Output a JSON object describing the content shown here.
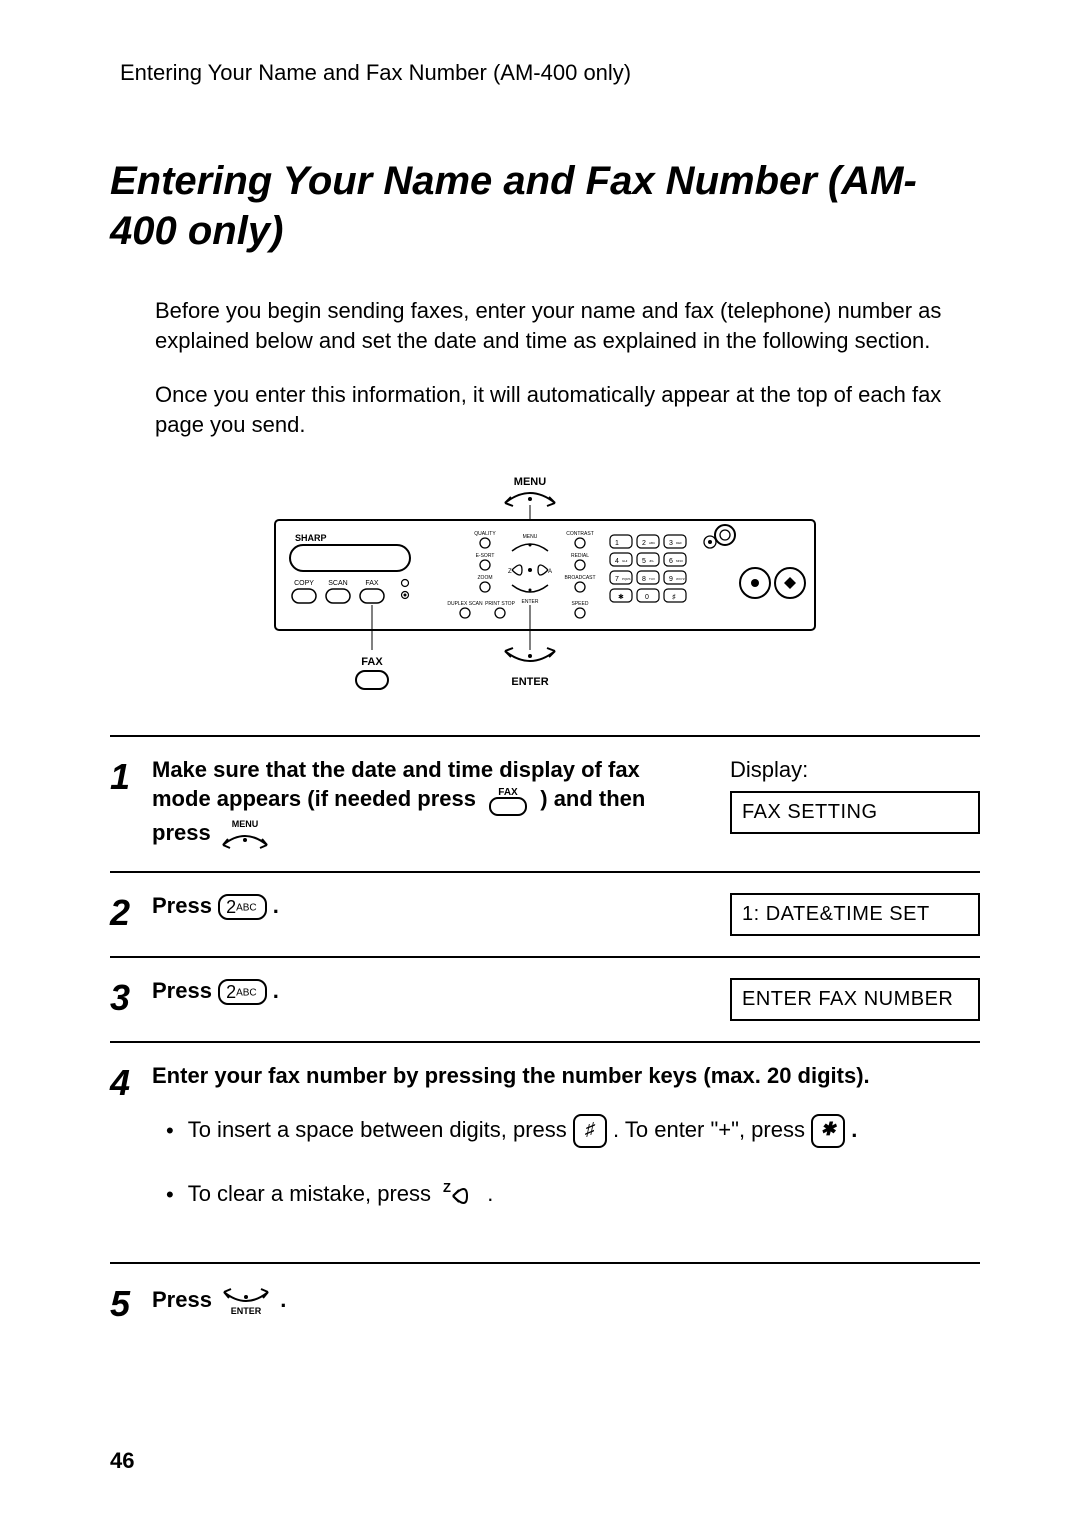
{
  "header": "Entering Your Name and Fax Number (AM-400 only)",
  "title": "Entering Your Name and Fax Number (AM-400 only)",
  "intro1": "Before you begin sending faxes, enter your name and fax (telephone) number as explained below and set the date and time as explained in the following section.",
  "intro2": "Once you enter this information, it will automatically appear at the top of each fax page you send.",
  "panel": {
    "brand": "SHARP",
    "mode_labels": [
      "COPY",
      "SCAN",
      "FAX"
    ],
    "col1": [
      "QUALITY",
      "E-SORT",
      "ZOOM",
      "DUPLEX SCAN",
      "PRINT STOP"
    ],
    "top_center_label": "MENU",
    "rocker_z": "Z",
    "rocker_a": "A",
    "enter_label": "ENTER",
    "col3": [
      "CONTRAST",
      "REDIAL",
      "BROADCAST",
      "SPEED"
    ],
    "keypad": [
      [
        "1",
        ""
      ],
      [
        "2",
        "ABC"
      ],
      [
        "3",
        "DEF"
      ],
      [
        "4",
        "GHI"
      ],
      [
        "5",
        "JKL"
      ],
      [
        "6",
        "MNO"
      ],
      [
        "7",
        "PQRS"
      ],
      [
        "8",
        "TUV"
      ],
      [
        "9",
        "WXYZ"
      ],
      [
        "✱",
        ""
      ],
      [
        "0",
        ""
      ],
      [
        "♯",
        ""
      ]
    ],
    "callout_menu": "MENU",
    "callout_fax": "FAX",
    "callout_enter": "ENTER"
  },
  "steps": {
    "s1": {
      "num": "1",
      "line1": "Make sure that the date and time display of fax mode appears (if needed press",
      "line2": ") and then press",
      "fax_label": "FAX",
      "menu_label": "MENU",
      "display_label": "Display:",
      "display_value": "FAX SETTING"
    },
    "s2": {
      "num": "2",
      "press": "Press",
      "key_main": "2",
      "key_sub": "ABC",
      "period": ".",
      "display_value": "1: DATE&TIME SET"
    },
    "s3": {
      "num": "3",
      "press": "Press",
      "key_main": "2",
      "key_sub": "ABC",
      "period": ".",
      "display_value": "ENTER FAX NUMBER"
    },
    "s4": {
      "num": "4",
      "heading": "Enter your fax number by pressing the number keys (max. 20 digits).",
      "b1a": "To insert a space between digits, press",
      "b1_key": "♯",
      "b1b": ". To enter \"+\", press",
      "b1_key2": "✱",
      "b1c": ".",
      "b2a": "To clear a mistake, press",
      "b2_label": "Z",
      "b2b": "."
    },
    "s5": {
      "num": "5",
      "press": "Press",
      "enter_label": "ENTER",
      "period": "."
    }
  },
  "page_number": "46"
}
